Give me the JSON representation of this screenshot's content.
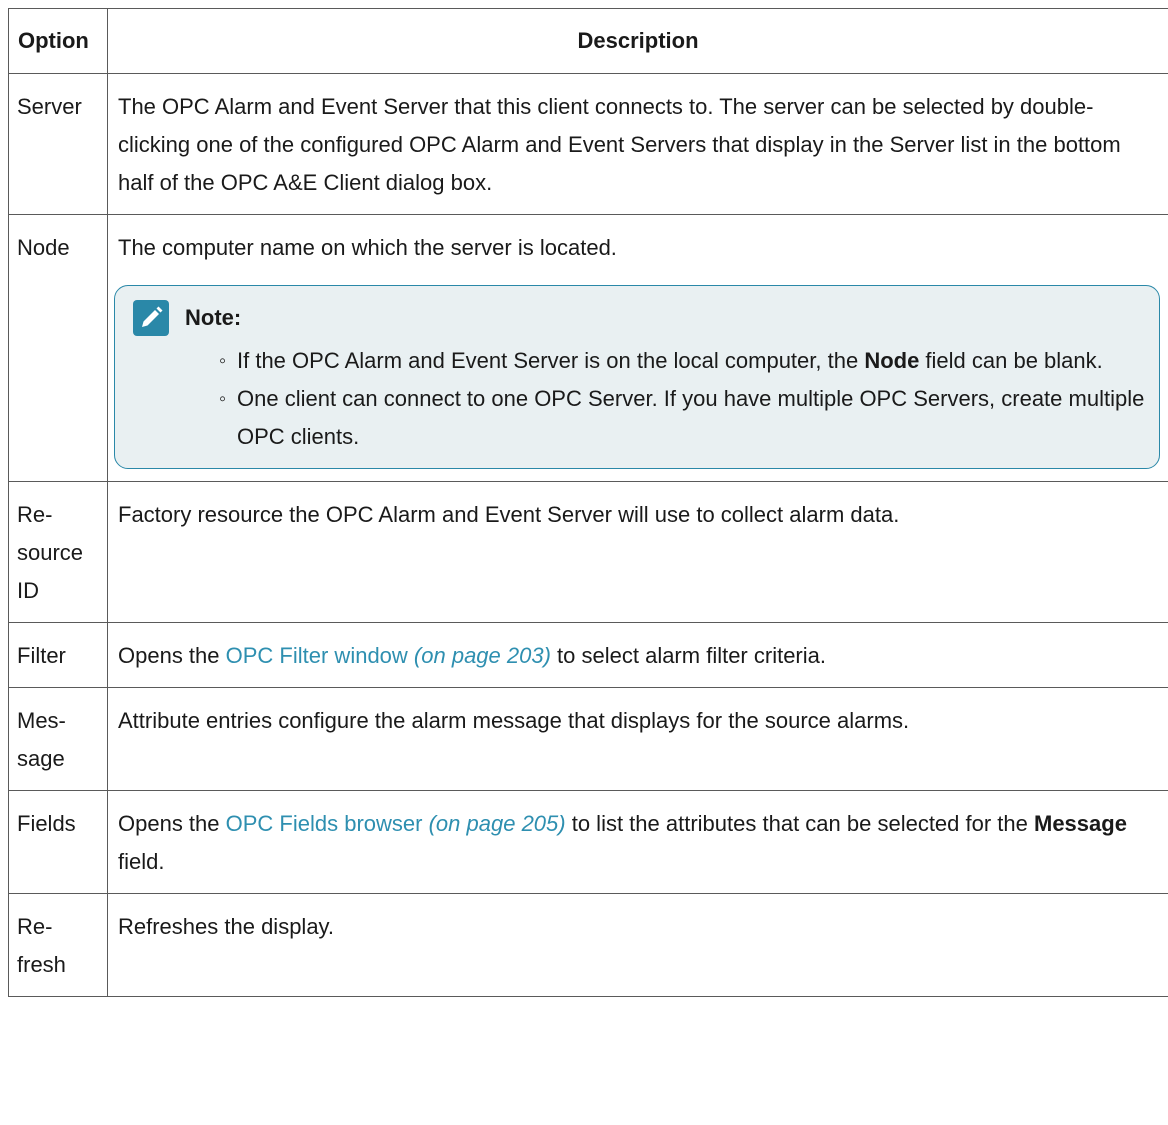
{
  "table": {
    "header": {
      "option": "Option",
      "description": "Description"
    },
    "rows": [
      {
        "option": "Server",
        "description": "The OPC Alarm and Event Server that this client connects to. The server can be selected by double-clicking one of the configured OPC Alarm and Event Servers that display in the Server list in the bottom half of the OPC A&E Client dialog box."
      },
      {
        "option": "Node",
        "description": "The computer name on which the server is located.",
        "note": {
          "icon": "pencil-icon",
          "title": "Note:",
          "item1": {
            "before": "If the OPC Alarm and Event Server is on the local computer, the ",
            "bold": "Node",
            "after": " field can be blank."
          },
          "item2": "One client can connect to one OPC Server. If you have multiple OPC Servers, create multiple OPC clients."
        }
      },
      {
        "option": "Re-source ID",
        "option_lines": [
          "Re-",
          "source",
          "ID"
        ],
        "description": "Factory resource the OPC Alarm and Event Server will use to collect alarm data."
      },
      {
        "option": "Filter",
        "link_text": "OPC Filter window",
        "link_page": "(on page 203)",
        "after": " to select alarm filter criteria.",
        "before": "Opens the "
      },
      {
        "option": "Mes-sage",
        "option_lines": [
          "Mes-",
          "sage"
        ],
        "description": "Attribute entries configure the alarm message that displays for the source alarms."
      },
      {
        "option": "Fields",
        "before": "Opens the ",
        "link_text": "OPC Fields browser",
        "link_page": "(on page 205)",
        "mid": " to list the attributes that can be selected for the ",
        "bold": "Message",
        "after": " field."
      },
      {
        "option": "Re-fresh",
        "option_lines": [
          "Re-",
          "fresh"
        ],
        "description": "Refreshes the display."
      }
    ]
  },
  "colors": {
    "link": "#2e8fb0",
    "note_border": "#2a88a8",
    "note_bg": "#e9f0f2",
    "icon_bg": "#2a88a8"
  }
}
